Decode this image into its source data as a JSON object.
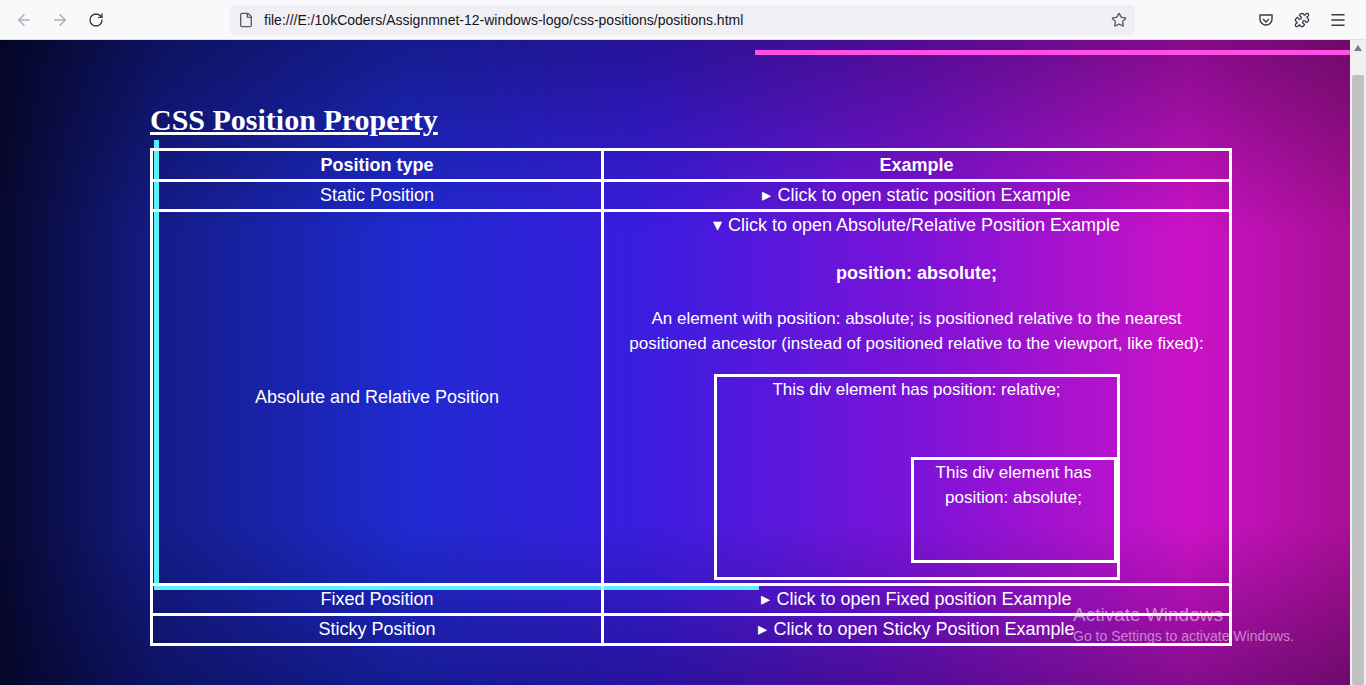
{
  "browser": {
    "url": "file:///E:/10kCoders/Assignmnet-12-windows-logo/css-positions/positions.html",
    "back_disabled": true,
    "forward_disabled": true
  },
  "page": {
    "heading": "CSS Position Property"
  },
  "table": {
    "columns": [
      "Position type",
      "Example"
    ],
    "rows": [
      {
        "type": "Static Position",
        "marker": "▸",
        "summary": "Click to open static position Example",
        "expanded": false
      },
      {
        "type": "Absolute and Relative Position",
        "marker": "▾",
        "summary": "Click to open Absolute/Relative Position Example",
        "expanded": true,
        "content": {
          "heading": "position: absolute;",
          "text": "An element with position: absolute; is positioned relative to the nearest positioned ancestor (instead of positioned relative to the viewport, like fixed):",
          "relative_box": "This div element has position: relative;",
          "absolute_box": "This div element has position: absolute;"
        }
      },
      {
        "type": "Fixed Position",
        "marker": "▸",
        "summary": "Click to open Fixed position Example",
        "expanded": false
      },
      {
        "type": "Sticky Position",
        "marker": "▸",
        "summary": "Click to open Sticky Position Example",
        "expanded": false
      }
    ]
  },
  "watermark": {
    "title": "Activate Windows",
    "subtitle": "Go to Settings to activate Windows."
  },
  "scrollbar": {
    "level": 0.97
  }
}
